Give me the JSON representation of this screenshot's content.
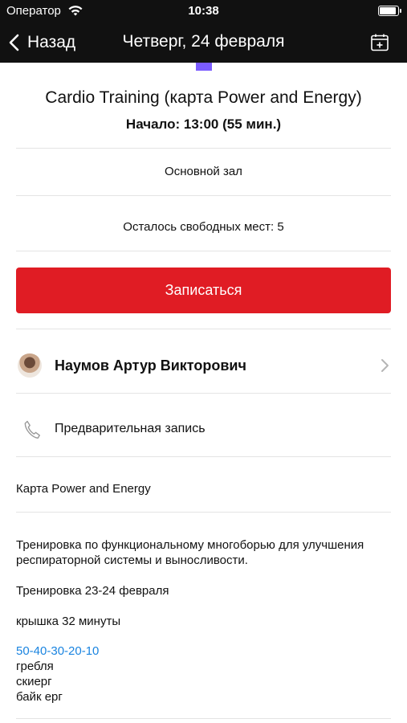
{
  "status_bar": {
    "carrier": "Оператор",
    "time": "10:38",
    "battery_level": 0.8
  },
  "nav": {
    "back_label": "Назад",
    "title": "Четверг, 24 февраля",
    "calendar_icon": "calendar-add-icon"
  },
  "event": {
    "title": "Cardio Training (карта Power and Energy)",
    "start": "Начало: 13:00 (55 мин.)",
    "hall": "Основной зал",
    "free_seats": "Осталось свободных мест: 5",
    "signup_label": "Записаться",
    "accent_color": "#e01c24"
  },
  "trainer": {
    "name": "Наумов Артур Викторович"
  },
  "booking": {
    "label": "Предварительная запись"
  },
  "card": {
    "name": "Карта Power and Energy"
  },
  "description": {
    "line1": "Тренировка по функциональному многоборью для улучшения респираторной системы и выносливости.",
    "line2": "Тренировка 23-24  февраля",
    "line3": "крышка 32 минуты",
    "link": "50-40-30-20-10",
    "items": [
      "гребля",
      "скиерг",
      "байк ерг"
    ]
  }
}
